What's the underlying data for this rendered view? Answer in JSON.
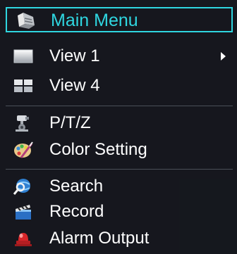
{
  "menu": {
    "header": {
      "label": "Main Menu",
      "icon": "main-menu-icon",
      "accent_color": "#2fd6e0"
    },
    "items": [
      {
        "label": "View 1",
        "icon": "single-view-icon",
        "has_submenu": true
      },
      {
        "label": "View 4",
        "icon": "quad-view-icon",
        "has_submenu": false
      },
      {
        "label": "P/T/Z",
        "icon": "ptz-camera-icon",
        "has_submenu": false
      },
      {
        "label": "Color Setting",
        "icon": "color-palette-icon",
        "has_submenu": false
      },
      {
        "label": "Search",
        "icon": "search-icon",
        "has_submenu": false
      },
      {
        "label": "Record",
        "icon": "record-clapper-icon",
        "has_submenu": false
      },
      {
        "label": "Alarm Output",
        "icon": "alarm-siren-icon",
        "has_submenu": false
      }
    ]
  }
}
